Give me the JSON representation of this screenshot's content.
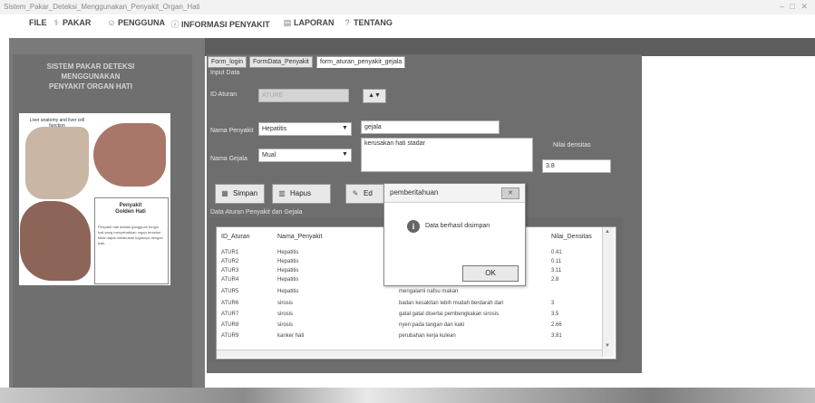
{
  "window": {
    "title": "Sistem_Pakar_Deteksi_Menggunakan_Penyakit_Organ_Hati",
    "controls": "– □ ✕"
  },
  "menu": [
    {
      "label": "FILE",
      "icon": "file-icon",
      "glyph": ""
    },
    {
      "label": "PAKAR",
      "icon": "doctor-icon",
      "glyph": "⚕"
    },
    {
      "label": "PENGGUNA",
      "icon": "user-icon",
      "glyph": "☺"
    },
    {
      "label": "INFORMASI PENYAKIT",
      "icon": "info-icon",
      "glyph": "ⓘ"
    },
    {
      "label": "LAPORAN",
      "icon": "report-icon",
      "glyph": "▤"
    },
    {
      "label": "TENTANG",
      "icon": "about-icon",
      "glyph": "?"
    }
  ],
  "sidebar": {
    "title": "SISTEM PAKAR DETEKSI\nMENGGUNAKAN\nPENYAKIT ORGAN HATI",
    "image_caption": "Liver anatomy and\nliver cell function",
    "hati_title": "Penyakit\nGolden Hati",
    "hati_text": "Penyakit hati adalah gangguan fungsi hati yang menyebabkan organ tersebut tidak dapat melakukan tugasnya dengan baik."
  },
  "tabs": [
    {
      "label": "Form_login"
    },
    {
      "label": "FormData_Penyakit"
    },
    {
      "label": "form_aturan_penyakit_gejala",
      "active": true
    }
  ],
  "form": {
    "group_title": "Input Data",
    "id_aturan": {
      "label": "ID Aturan",
      "value": "ATURE"
    },
    "spinner": "▲▼",
    "nama_penyakit": {
      "label": "Nama Penyakit",
      "value": "Hepatitis",
      "extra_value": "gejala"
    },
    "gejala_text": "kerusakan hati stadar",
    "nama_gejala": {
      "label": "Nama Gejala",
      "value": "Mual"
    },
    "nilai": {
      "label": "Nilai densitas",
      "value": "3.8"
    },
    "buttons": {
      "simpan": {
        "label": "Simpan",
        "glyph": "▦"
      },
      "hapus": {
        "label": "Hapus",
        "glyph": "▥"
      },
      "edit": {
        "label": "Ed",
        "glyph": "✎"
      }
    }
  },
  "table": {
    "group_title": "Data Aturan Penyakit dan Gejala",
    "columns": [
      "ID_Aturan",
      "Nama_Penyakit",
      "Nilai_Densitas"
    ],
    "rows": [
      {
        "id": "ATUR1",
        "penyakit": "Hepatitis",
        "gejala": "",
        "nilai": "0.41"
      },
      {
        "id": "ATUR2",
        "penyakit": "Hepatitis",
        "gejala": "",
        "nilai": "0.11"
      },
      {
        "id": "ATUR3",
        "penyakit": "Hepatitis",
        "gejala": "",
        "nilai": "3.11"
      },
      {
        "id": "ATUR4",
        "penyakit": "Hepatitis",
        "gejala": "",
        "nilai": "2.8"
      },
      {
        "id": "ATUR5",
        "penyakit": "Hepatitis",
        "gejala": "mengalami nafsu makan",
        "nilai": ""
      },
      {
        "id": "ATUR6",
        "penyakit": "sirosis",
        "gejala": "badan kesakitan lebih mudah berdarah dari",
        "nilai": "3"
      },
      {
        "id": "ATUR7",
        "penyakit": "sirosis",
        "gejala": "gatal gatal disertai pembengkakan sirosis",
        "nilai": "3.5"
      },
      {
        "id": "ATUR8",
        "penyakit": "sirosis",
        "gejala": "nyeri pada tangan dan kaki",
        "nilai": "2.66"
      },
      {
        "id": "ATUR9",
        "penyakit": "kanker hati",
        "gejala": "perubahan kerja kulean",
        "nilai": "3.81"
      }
    ]
  },
  "dialog": {
    "title": "pemberitahuan",
    "message": "Data berhasil disimpan",
    "ok_label": "OK",
    "close_glyph": "✕",
    "icon_glyph": "i"
  }
}
